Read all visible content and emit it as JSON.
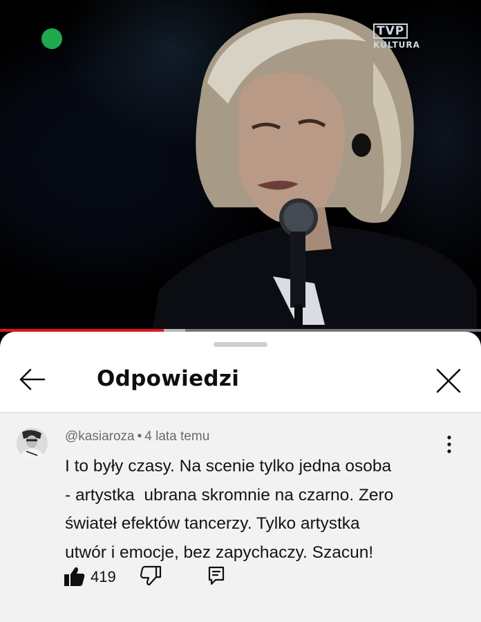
{
  "video": {
    "channel_logo": "TVP",
    "channel_logo_sub": "KULTURA",
    "progress": 0.34,
    "buffered": 0.385
  },
  "sheet": {
    "title": "Odpowiedzi",
    "back_icon": "arrow-left-icon",
    "close_icon": "close-icon"
  },
  "comment": {
    "author": "@kasiaroza",
    "separator": "•",
    "time": "4 lata temu",
    "lines": [
      "I to były czasy. Na scenie tylko jedna osoba",
      "- artystka  ubrana skromnie na czarno. Zero",
      "świateł efektów tancerzy. Tylko artystka",
      "utwór i emocje, bez zapychaczy. Szacun!"
    ],
    "likes": "419",
    "icons": {
      "menu": "more-vertical-icon",
      "like": "thumb-up-icon",
      "dislike": "thumb-down-icon",
      "reply": "reply-icon"
    }
  },
  "colors": {
    "progress": "#e0171b",
    "sheet_bg": "#ffffff",
    "comment_bg": "#f2f2f2",
    "text": "#0f0f0f",
    "muted": "#6a6a6a"
  }
}
